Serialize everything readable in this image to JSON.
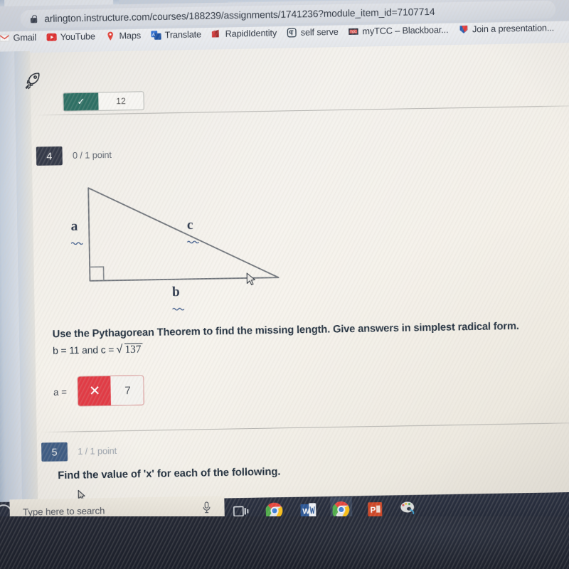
{
  "browser": {
    "url": "arlington.instructure.com/courses/188239/assignments/1741236?module_item_id=7107714",
    "lock_icon": "lock-icon",
    "bookmarks": [
      {
        "label": "Gmail",
        "icon": "gmail-icon"
      },
      {
        "label": "YouTube",
        "icon": "youtube-icon"
      },
      {
        "label": "Maps",
        "icon": "maps-pin-icon"
      },
      {
        "label": "Translate",
        "icon": "translate-icon"
      },
      {
        "label": "RapidIdentity",
        "icon": "rapididentity-icon"
      },
      {
        "label": "self serve",
        "icon": "self-serve-icon"
      },
      {
        "label": "myTCC – Blackboar...",
        "icon": "mytcc-icon"
      },
      {
        "label": "Join a presentation...",
        "icon": "presentation-icon"
      }
    ]
  },
  "page": {
    "rocket_icon": "rocket-icon",
    "previous_question": {
      "check_icon": "check-icon",
      "value": "12"
    },
    "question4": {
      "number": "4",
      "points": "0 / 1 point",
      "badge_color": "#353a49",
      "diagram": {
        "type": "right-triangle",
        "labels": {
          "leg_vertical": "a",
          "leg_horizontal": "b",
          "hypotenuse": "c"
        },
        "right_angle_marker": true,
        "label_color": "#2f3a4e"
      },
      "prompt": "Use the Pythagorean Theorem to find the missing length.  Give answers in simplest radical form.",
      "given_prefix": "b = 11 and c = ",
      "given_radicand": "137",
      "radical_symbol": "√",
      "answer_label": "a =",
      "answer_mark": "✕",
      "answer_value": "7",
      "answer_status_color": "#e03b45"
    },
    "question5": {
      "number": "5",
      "points": "1 / 1 point",
      "badge_color": "#3f5d85",
      "prompt": "Find the value of 'x' for each of the following."
    }
  },
  "taskbar": {
    "start_icon": "start-circle-icon",
    "search_placeholder": "Type here to search",
    "mic_icon": "microphone-icon",
    "items": [
      {
        "icon": "task-view-icon",
        "label": "Task View",
        "active": false
      },
      {
        "icon": "chrome-icon",
        "label": "Google Chrome",
        "active": false
      },
      {
        "icon": "word-icon",
        "label": "Microsoft Word",
        "active": true
      },
      {
        "icon": "chrome-icon",
        "label": "Google Chrome",
        "active": true
      },
      {
        "icon": "powerpoint-icon",
        "label": "Microsoft PowerPoint",
        "active": true
      },
      {
        "icon": "paint-icon",
        "label": "Paint",
        "active": true
      }
    ]
  }
}
